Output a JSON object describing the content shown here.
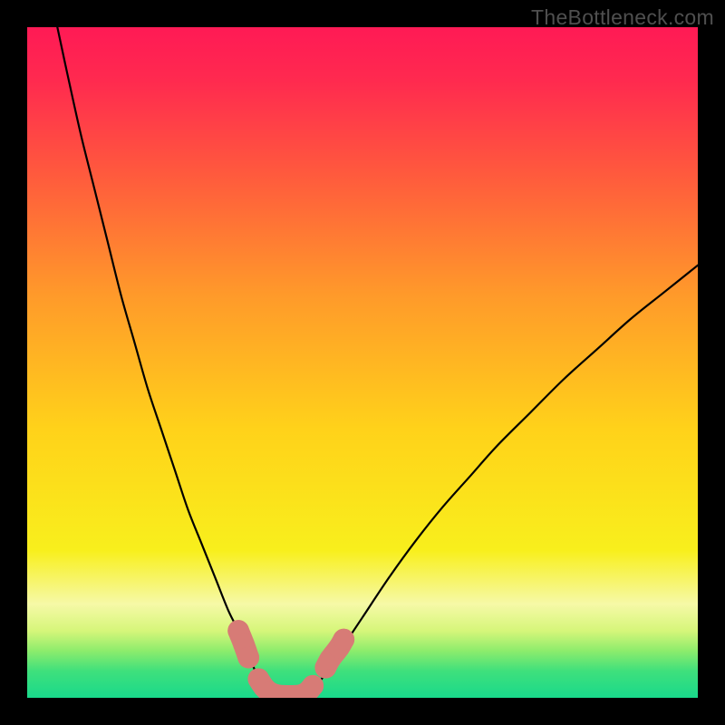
{
  "watermark": "TheBottleneck.com",
  "chart_data": {
    "type": "line",
    "title": "",
    "xlabel": "",
    "ylabel": "",
    "xlim": [
      0,
      100
    ],
    "ylim": [
      0,
      100
    ],
    "background_gradient": {
      "stops": [
        {
          "pos": 0.0,
          "color": "#ff1a55"
        },
        {
          "pos": 0.08,
          "color": "#ff2a4f"
        },
        {
          "pos": 0.22,
          "color": "#ff5a3d"
        },
        {
          "pos": 0.4,
          "color": "#ff9a2a"
        },
        {
          "pos": 0.6,
          "color": "#ffd21a"
        },
        {
          "pos": 0.78,
          "color": "#f8ef1c"
        },
        {
          "pos": 0.86,
          "color": "#f6f9a7"
        },
        {
          "pos": 0.9,
          "color": "#d6f67a"
        },
        {
          "pos": 0.93,
          "color": "#8dec6c"
        },
        {
          "pos": 0.96,
          "color": "#3fe07c"
        },
        {
          "pos": 1.0,
          "color": "#19d98b"
        }
      ]
    },
    "series": [
      {
        "name": "curve-left",
        "stroke": "#000000",
        "width": 2.2,
        "points": [
          {
            "x": 4.5,
            "y": 100
          },
          {
            "x": 6.0,
            "y": 93
          },
          {
            "x": 8.0,
            "y": 84
          },
          {
            "x": 10.0,
            "y": 76
          },
          {
            "x": 12.0,
            "y": 68
          },
          {
            "x": 14.0,
            "y": 60
          },
          {
            "x": 16.0,
            "y": 53
          },
          {
            "x": 18.0,
            "y": 46
          },
          {
            "x": 20.0,
            "y": 40
          },
          {
            "x": 22.0,
            "y": 34
          },
          {
            "x": 24.0,
            "y": 28
          },
          {
            "x": 26.0,
            "y": 23
          },
          {
            "x": 28.0,
            "y": 18
          },
          {
            "x": 30.0,
            "y": 13
          },
          {
            "x": 31.5,
            "y": 10
          },
          {
            "x": 33.0,
            "y": 6.5
          },
          {
            "x": 34.0,
            "y": 4.0
          },
          {
            "x": 35.0,
            "y": 2.2
          },
          {
            "x": 35.8,
            "y": 1.0
          },
          {
            "x": 36.5,
            "y": 0.4
          }
        ]
      },
      {
        "name": "curve-bottom",
        "stroke": "#000000",
        "width": 2.2,
        "points": [
          {
            "x": 36.5,
            "y": 0.4
          },
          {
            "x": 38.0,
            "y": 0.2
          },
          {
            "x": 40.0,
            "y": 0.2
          },
          {
            "x": 41.5,
            "y": 0.4
          }
        ]
      },
      {
        "name": "curve-right",
        "stroke": "#000000",
        "width": 2.2,
        "points": [
          {
            "x": 41.5,
            "y": 0.4
          },
          {
            "x": 42.5,
            "y": 1.0
          },
          {
            "x": 43.5,
            "y": 2.2
          },
          {
            "x": 45.0,
            "y": 4.5
          },
          {
            "x": 47.0,
            "y": 7.5
          },
          {
            "x": 50.0,
            "y": 12.0
          },
          {
            "x": 54.0,
            "y": 18.0
          },
          {
            "x": 58.0,
            "y": 23.5
          },
          {
            "x": 62.0,
            "y": 28.5
          },
          {
            "x": 66.0,
            "y": 33.0
          },
          {
            "x": 70.0,
            "y": 37.5
          },
          {
            "x": 75.0,
            "y": 42.5
          },
          {
            "x": 80.0,
            "y": 47.5
          },
          {
            "x": 85.0,
            "y": 52.0
          },
          {
            "x": 90.0,
            "y": 56.5
          },
          {
            "x": 95.0,
            "y": 60.5
          },
          {
            "x": 100.0,
            "y": 64.5
          }
        ]
      }
    ],
    "markers": {
      "color": "#d77b76",
      "radius": 1.6,
      "segments": [
        {
          "name": "dots-left",
          "points": [
            {
              "x": 31.5,
              "y": 10.0
            },
            {
              "x": 32.3,
              "y": 8.0
            },
            {
              "x": 33.0,
              "y": 6.0
            }
          ]
        },
        {
          "name": "cluster-bottom",
          "points": [
            {
              "x": 34.5,
              "y": 2.8
            },
            {
              "x": 35.3,
              "y": 1.6
            },
            {
              "x": 36.2,
              "y": 0.8
            },
            {
              "x": 37.3,
              "y": 0.4
            },
            {
              "x": 38.5,
              "y": 0.3
            },
            {
              "x": 39.7,
              "y": 0.3
            },
            {
              "x": 40.8,
              "y": 0.4
            },
            {
              "x": 41.8,
              "y": 0.9
            },
            {
              "x": 42.6,
              "y": 1.8
            }
          ]
        },
        {
          "name": "dots-right",
          "points": [
            {
              "x": 44.5,
              "y": 4.5
            },
            {
              "x": 45.2,
              "y": 5.8
            },
            {
              "x": 46.5,
              "y": 7.5
            },
            {
              "x": 47.2,
              "y": 8.7
            }
          ]
        }
      ]
    }
  }
}
